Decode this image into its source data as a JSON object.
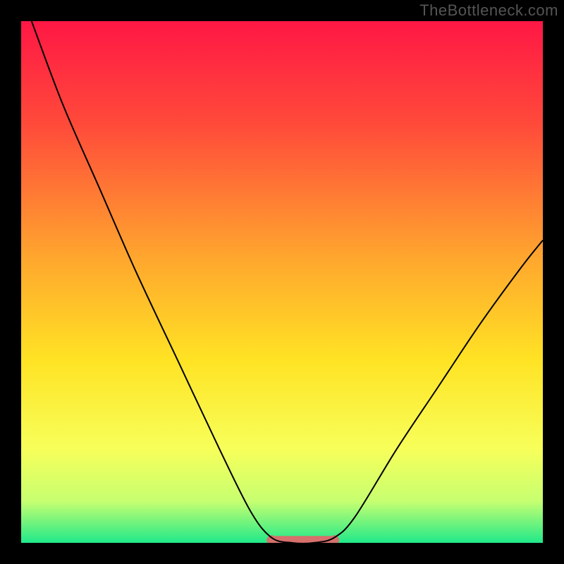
{
  "watermark": "TheBottleneck.com",
  "chart_data": {
    "type": "line",
    "title": "",
    "xlabel": "",
    "ylabel": "",
    "xlim": [
      0,
      100
    ],
    "ylim": [
      0,
      100
    ],
    "background_gradient": {
      "stops": [
        {
          "offset": 0,
          "color": "#ff1745"
        },
        {
          "offset": 20,
          "color": "#ff4b3a"
        },
        {
          "offset": 45,
          "color": "#ffa52e"
        },
        {
          "offset": 65,
          "color": "#ffe324"
        },
        {
          "offset": 82,
          "color": "#f7ff5a"
        },
        {
          "offset": 92,
          "color": "#c7ff70"
        },
        {
          "offset": 100,
          "color": "#20e98a"
        }
      ]
    },
    "series": [
      {
        "name": "bottleneck-curve",
        "color": "#000000",
        "width": 2,
        "points": [
          {
            "x": 2,
            "y": 100
          },
          {
            "x": 8,
            "y": 84
          },
          {
            "x": 15,
            "y": 68
          },
          {
            "x": 22,
            "y": 52
          },
          {
            "x": 30,
            "y": 35
          },
          {
            "x": 38,
            "y": 18
          },
          {
            "x": 44,
            "y": 6
          },
          {
            "x": 48,
            "y": 1
          },
          {
            "x": 52,
            "y": 0
          },
          {
            "x": 56,
            "y": 0
          },
          {
            "x": 60,
            "y": 1
          },
          {
            "x": 64,
            "y": 5
          },
          {
            "x": 72,
            "y": 18
          },
          {
            "x": 80,
            "y": 30
          },
          {
            "x": 88,
            "y": 42
          },
          {
            "x": 96,
            "y": 53
          },
          {
            "x": 100,
            "y": 58
          }
        ]
      }
    ],
    "flat_zone": {
      "color": "#d6706c",
      "x_start": 48,
      "x_end": 60,
      "y": 0.5,
      "thickness": 12,
      "end_radius": 7
    }
  }
}
